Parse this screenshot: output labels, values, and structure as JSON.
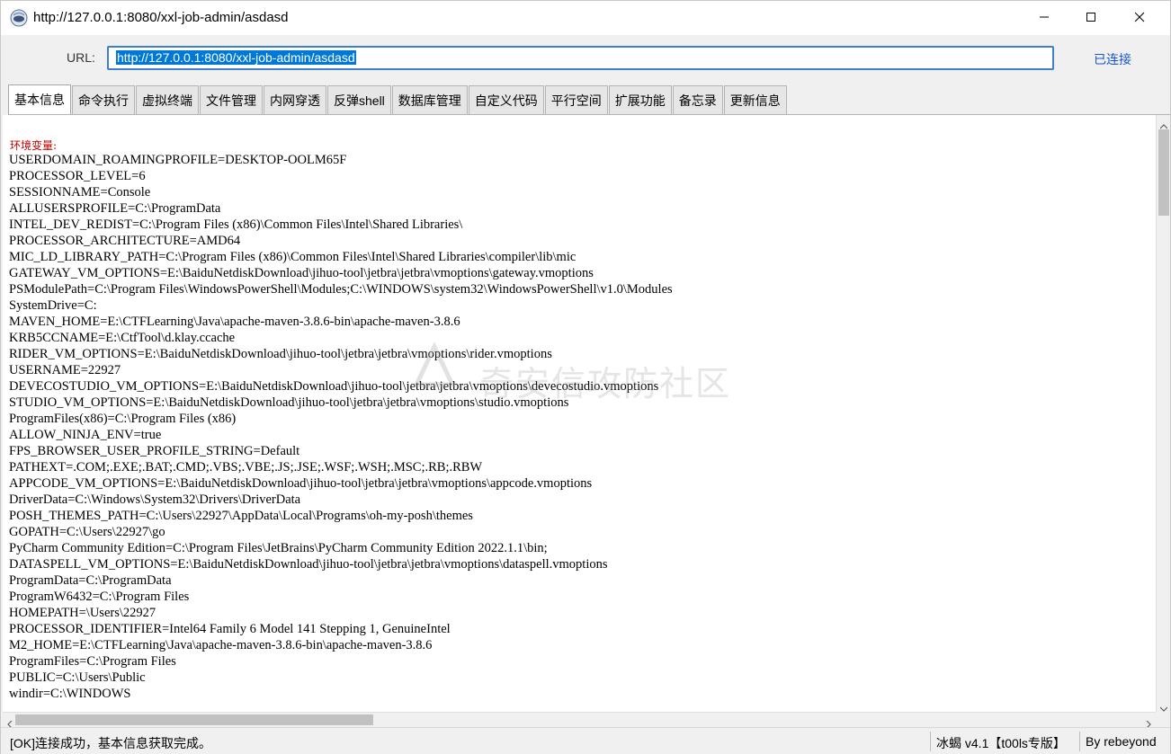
{
  "window": {
    "title": "http://127.0.0.1:8080/xxl-job-admin/asdasd"
  },
  "urlbar": {
    "label": "URL:",
    "value": "http://127.0.0.1:8080/xxl-job-admin/asdasd",
    "status": "已连接"
  },
  "tabs": [
    {
      "label": "基本信息",
      "active": true
    },
    {
      "label": "命令执行"
    },
    {
      "label": "虚拟终端"
    },
    {
      "label": "文件管理"
    },
    {
      "label": "内网穿透"
    },
    {
      "label": "反弹shell"
    },
    {
      "label": "数据库管理"
    },
    {
      "label": "自定义代码"
    },
    {
      "label": "平行空间"
    },
    {
      "label": "扩展功能"
    },
    {
      "label": "备忘录"
    },
    {
      "label": "更新信息"
    }
  ],
  "content": {
    "env_header": "环境变量:",
    "env_lines": [
      "USERDOMAIN_ROAMINGPROFILE=DESKTOP-OOLM65F",
      "PROCESSOR_LEVEL=6",
      "SESSIONNAME=Console",
      "ALLUSERSPROFILE=C:\\ProgramData",
      "INTEL_DEV_REDIST=C:\\Program Files (x86)\\Common Files\\Intel\\Shared Libraries\\",
      "PROCESSOR_ARCHITECTURE=AMD64",
      "MIC_LD_LIBRARY_PATH=C:\\Program Files (x86)\\Common Files\\Intel\\Shared Libraries\\compiler\\lib\\mic",
      "GATEWAY_VM_OPTIONS=E:\\BaiduNetdiskDownload\\jihuo-tool\\jetbra\\jetbra\\vmoptions\\gateway.vmoptions",
      "PSModulePath=C:\\Program Files\\WindowsPowerShell\\Modules;C:\\WINDOWS\\system32\\WindowsPowerShell\\v1.0\\Modules",
      "SystemDrive=C:",
      "MAVEN_HOME=E:\\CTFLearning\\Java\\apache-maven-3.8.6-bin\\apache-maven-3.8.6",
      "KRB5CCNAME=E:\\CtfTool\\d.klay.ccache",
      "RIDER_VM_OPTIONS=E:\\BaiduNetdiskDownload\\jihuo-tool\\jetbra\\jetbra\\vmoptions\\rider.vmoptions",
      "USERNAME=22927",
      "DEVECOSTUDIO_VM_OPTIONS=E:\\BaiduNetdiskDownload\\jihuo-tool\\jetbra\\jetbra\\vmoptions\\devecostudio.vmoptions",
      "STUDIO_VM_OPTIONS=E:\\BaiduNetdiskDownload\\jihuo-tool\\jetbra\\jetbra\\vmoptions\\studio.vmoptions",
      "ProgramFiles(x86)=C:\\Program Files (x86)",
      "ALLOW_NINJA_ENV=true",
      "FPS_BROWSER_USER_PROFILE_STRING=Default",
      "PATHEXT=.COM;.EXE;.BAT;.CMD;.VBS;.VBE;.JS;.JSE;.WSF;.WSH;.MSC;.RB;.RBW",
      "APPCODE_VM_OPTIONS=E:\\BaiduNetdiskDownload\\jihuo-tool\\jetbra\\jetbra\\vmoptions\\appcode.vmoptions",
      "DriverData=C:\\Windows\\System32\\Drivers\\DriverData",
      "POSH_THEMES_PATH=C:\\Users\\22927\\AppData\\Local\\Programs\\oh-my-posh\\themes",
      "GOPATH=C:\\Users\\22927\\go",
      "PyCharm Community Edition=C:\\Program Files\\JetBrains\\PyCharm Community Edition 2022.1.1\\bin;",
      "DATASPELL_VM_OPTIONS=E:\\BaiduNetdiskDownload\\jihuo-tool\\jetbra\\jetbra\\vmoptions\\dataspell.vmoptions",
      "ProgramData=C:\\ProgramData",
      "ProgramW6432=C:\\Program Files",
      "HOMEPATH=\\Users\\22927",
      "PROCESSOR_IDENTIFIER=Intel64 Family 6 Model 141 Stepping 1, GenuineIntel",
      "M2_HOME=E:\\CTFLearning\\Java\\apache-maven-3.8.6-bin\\apache-maven-3.8.6",
      "ProgramFiles=C:\\Program Files",
      "PUBLIC=C:\\Users\\Public",
      "windir=C:\\WINDOWS"
    ],
    "watermark": "奇安信攻防社区"
  },
  "statusbar": {
    "message": "[OK]连接成功，基本信息获取完成。",
    "version": "冰蝎 v4.1【t00ls专版】",
    "author": "By rebeyond"
  },
  "icons": {
    "app": "bee-logo-icon",
    "minimize": "minimize-icon",
    "maximize": "maximize-icon",
    "close": "close-icon"
  },
  "colors": {
    "accent": "#0078d7",
    "input_border": "#3d7ecf",
    "connected": "#1a56c4",
    "env_header": "#c00000"
  }
}
